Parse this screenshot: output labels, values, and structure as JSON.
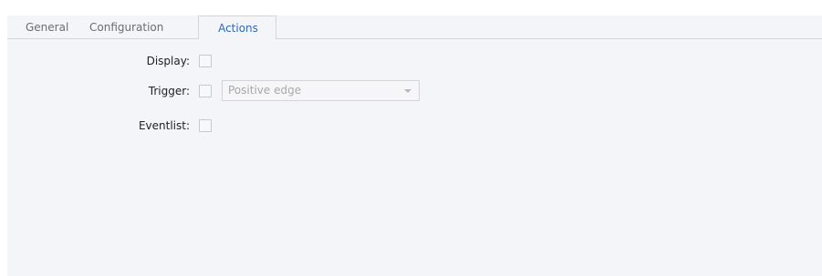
{
  "tabs": {
    "general": "General",
    "configuration": "Configuration",
    "actions": "Actions",
    "active": "Actions"
  },
  "actions": {
    "display": {
      "label": "Display:",
      "checked": false
    },
    "trigger": {
      "label": "Trigger:",
      "checked": false,
      "mode": "Positive edge"
    },
    "eventlist": {
      "label": "Eventlist:",
      "checked": false
    }
  },
  "colors": {
    "panel_background": "#f4f5f9",
    "active_tab_text": "#2e6ab8",
    "inactive_tab_text": "#6d6d6d",
    "border": "#d3d5da"
  }
}
